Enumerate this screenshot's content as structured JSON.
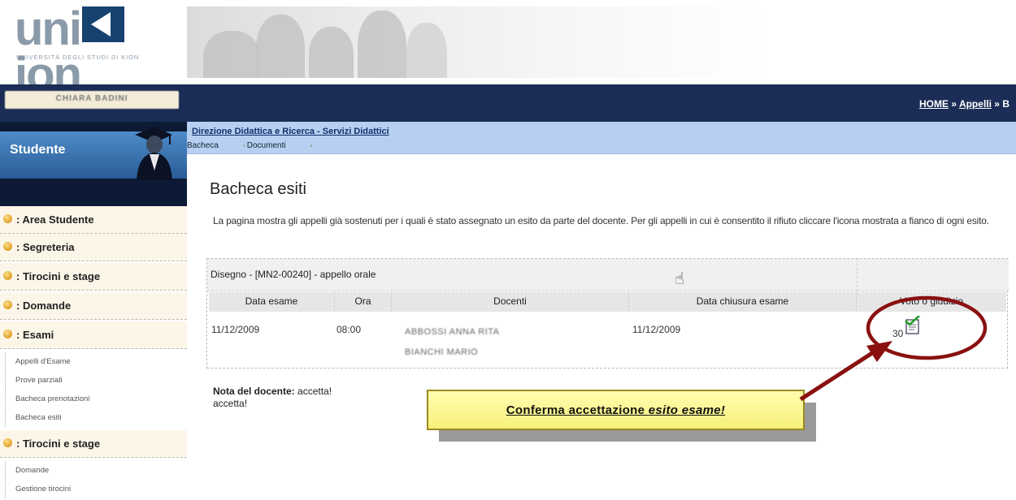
{
  "logo": {
    "word_pre": "uni",
    "word_post": "ion",
    "subtitle": "UNIVERSITÀ DEGLI STUDI DI KION"
  },
  "user": {
    "name": "CHIARA BADINI"
  },
  "nav": {
    "breadcrumb": [
      {
        "label": "HOME"
      },
      {
        "label": "Appelli"
      },
      {
        "label": "B"
      }
    ],
    "sep": "»"
  },
  "student": {
    "label": "Studente"
  },
  "subbar": {
    "title": "Direzione Didattica e Ricerca - Servizi Didattici",
    "tabs": [
      "Bacheca",
      "Documenti",
      ""
    ]
  },
  "sidebar": {
    "items": [
      {
        "label": ": Area Studente"
      },
      {
        "label": ": Segreteria"
      },
      {
        "label": ": Tirocini e stage"
      },
      {
        "label": ": Domande"
      },
      {
        "label": ": Esami"
      }
    ],
    "esami_sub": [
      "Appelli d'Esame",
      "Prove parziali",
      "Bacheca prenotazioni",
      "Bacheca esiti"
    ],
    "tirocini": {
      "label": ": Tirocini e stage"
    },
    "tirocini_sub": [
      "Domande",
      "Gestione tirocini"
    ]
  },
  "main": {
    "title": "Bacheca esiti",
    "intro": "La pagina mostra gli appelli già sostenuti per i quali è stato assegnato un esito da parte del docente. Per gli appelli in cui è consentito il rifiuto cliccare l'icona mostrata a fianco di ogni esito.",
    "exam": {
      "title": "Disegno - [MN2-00240] - appello orale",
      "columns": [
        "Data esame",
        "Ora",
        "Docenti",
        "Data chiusura esame",
        "Voto o giudizio"
      ],
      "row": {
        "data_esame": "11/12/2009",
        "ora": "08:00",
        "docenti": [
          "ABBOSSI ANNA RITA",
          "BIANCHI MARIO"
        ],
        "data_chiusura": "11/12/2009",
        "voto": "30"
      }
    },
    "note_label": "Nota del docente:",
    "note_text": "accetta!",
    "note_text2": "accetta!"
  },
  "callout": {
    "text_pre": "Conferma accettazione ",
    "text_em": "esito esame!"
  },
  "colors": {
    "nav": "#1b2d56",
    "subbar": "#b7cff0",
    "callout": "#f7f07a",
    "arrow": "#8a1010"
  }
}
